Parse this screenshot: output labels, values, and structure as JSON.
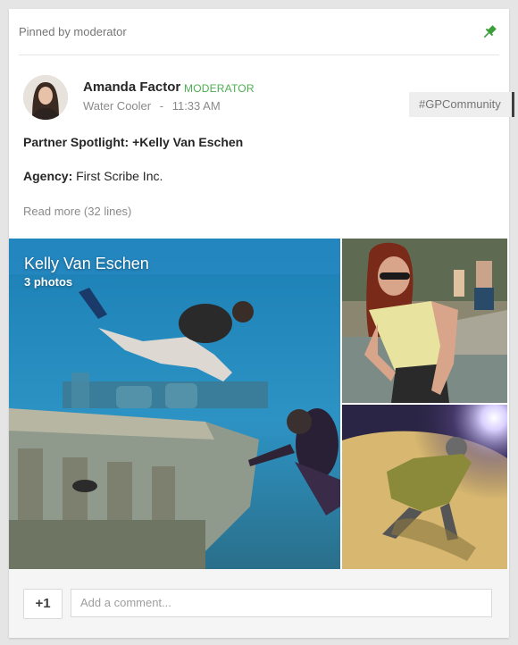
{
  "post": {
    "pinned_text": "Pinned by moderator",
    "author": {
      "name": "Amanda Factor",
      "badge": "MODERATOR",
      "category": "Water Cooler",
      "separator": "-",
      "time": "11:33 AM"
    },
    "hashtag": "#GPCommunity",
    "body": {
      "spotlight": "Partner Spotlight: +Kelly Van Eschen",
      "agency_label": "Agency:",
      "agency_value": "First Scribe Inc.",
      "read_more": "Read more (32 lines)"
    },
    "album": {
      "title": "Kelly Van Eschen",
      "count": "3 photos"
    }
  },
  "footer": {
    "plus_one": "+1",
    "comment_placeholder": "Add a comment..."
  },
  "colors": {
    "accent_green": "#4caf50",
    "pin_icon": "#3a9f3a"
  }
}
